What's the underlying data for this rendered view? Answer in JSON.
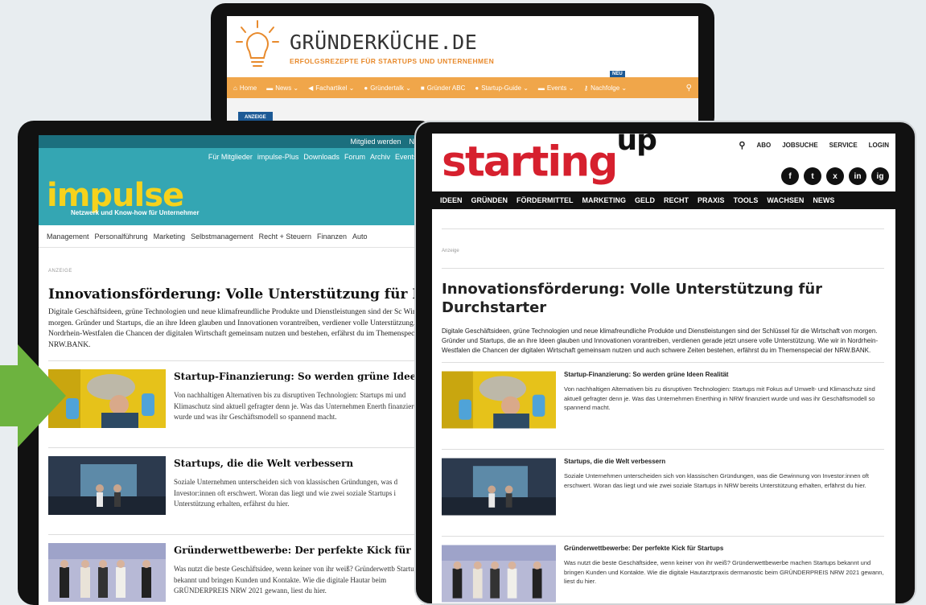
{
  "gruenderkueche": {
    "title": "GRÜNDERKÜCHE.DE",
    "subtitle": "ERFOLGSREZEPTE FÜR STARTUPS UND UNTERNEHMEN",
    "neu_badge": "NEU",
    "nav": [
      {
        "icon": "home-icon",
        "label": "Home"
      },
      {
        "icon": "news-icon",
        "label": "News ⌄"
      },
      {
        "icon": "megaphone-icon",
        "label": "Fachartikel ⌄"
      },
      {
        "icon": "chat-icon",
        "label": "Gründertalk ⌄"
      },
      {
        "icon": "book-icon",
        "label": "Gründer ABC"
      },
      {
        "icon": "bulb-icon",
        "label": "Startup-Guide ⌄"
      },
      {
        "icon": "calendar-icon",
        "label": "Events ⌄"
      },
      {
        "icon": "key-icon",
        "label": "Nachfolge ⌄"
      }
    ],
    "ad_label": "ANZEIGE",
    "accent": "#f0a64a"
  },
  "impulse": {
    "topbar": [
      "Mitglied werden",
      "Newsle"
    ],
    "links": [
      "Für Mitglieder",
      "impulse-Plus",
      "Downloads",
      "Forum",
      "Archiv",
      "Events",
      "Hö"
    ],
    "logo": "impulse",
    "tagline": "Netzwerk und Know-how für Unternehmer",
    "categories": [
      "Management",
      "Personalführung",
      "Marketing",
      "Selbstmanagement",
      "Recht + Steuern",
      "Finanzen",
      "Auto"
    ],
    "ad_label": "ANZEIGE",
    "headline": "Innovationsförderung: Volle Unterstützung für Durchstarter",
    "intro": "Digitale Geschäftsideen, grüne Technologien und neue klimafreundliche Produkte und Dienstleistungen sind der Sc Wirtschaft von morgen. Gründer und Startups, die an ihre Ideen glauben und Innovationen vorantreiben, verdiener volle Unterstützung. Wie wir in Nordrhein-Westfalen die Chancen der digitalen Wirtschaft gemeinsam nutzen und bestehen, erfährst du im Themenspecial der NRW.BANK.",
    "articles": [
      {
        "title": "Startup-Finanzierung: So werden grüne Ideen Realit",
        "text": "Von nachhaltigen Alternativen bis zu disruptiven Technologien: Startups mi und Klimaschutz sind aktuell gefragter denn je. Was das Unternehmen Enerth finanziert wurde und was ihr Geschäftsmodell so spannend macht."
      },
      {
        "title": "Startups, die die Welt verbessern",
        "text": "Soziale Unternehmen unterscheiden sich von klassischen Gründungen, was d Investor:innen oft erschwert. Woran das liegt und wie zwei soziale Startups i Unterstützung erhalten, erfährst du hier."
      },
      {
        "title": "Gründerwettbewerbe: Der perfekte Kick für Startups",
        "text": "Was nutzt die beste Geschäftsidee, wenn keiner von ihr weiß? Gründerwettb Startups bekannt und bringen Kunden und Kontakte. Wie die digitale Hautar beim GRÜNDERPREIS NRW 2021 gewann, liest du hier."
      }
    ]
  },
  "startingup": {
    "logo_main": "starting",
    "logo_sup": "up",
    "util": [
      "ABO",
      "JOBSUCHE",
      "SERVICE",
      "LOGIN"
    ],
    "social": [
      "f",
      "t",
      "x",
      "in",
      "ig"
    ],
    "nav": [
      "IDEEN",
      "GRÜNDEN",
      "FÖRDERMITTEL",
      "MARKETING",
      "GELD",
      "RECHT",
      "PRAXIS",
      "TOOLS",
      "WACHSEN",
      "NEWS"
    ],
    "ad_label": "Anzeige",
    "headline": "Innovationsförderung: Volle Unterstützung für Durchstarter",
    "intro": "Digitale Geschäftsideen, grüne Technologien und neue klimafreundliche Produkte und Dienstleistungen sind der Schlüssel für die Wirtschaft von morgen. Gründer und Startups, die an ihre Ideen glauben und Innovationen vorantreiben, verdienen gerade jetzt unsere volle Unterstützung. Wie wir in Nordrhein-Westfalen die Chancen der digitalen Wirtschaft gemeinsam nutzen und auch schwere Zeiten bestehen, erfährst du im Themenspecial der NRW.BANK.",
    "articles": [
      {
        "title": "Startup-Finanzierung: So werden grüne Ideen Realität",
        "text": "Von nachhaltigen Alternativen bis zu disruptiven Technologien: Startups mit Fokus auf Umwelt- und Klimaschutz sind aktuell gefragter denn je. Was das Unternehmen Enerthing in NRW finanziert wurde und was ihr Geschäftsmodell so spannend macht."
      },
      {
        "title": "Startups, die die Welt verbessern",
        "text": "Soziale Unternehmen unterscheiden sich von klassischen Gründungen, was die Gewinnung von Investor:innen oft erschwert. Woran das liegt und wie zwei soziale Startups in NRW bereits Unterstützung erhalten, erfährst du hier."
      },
      {
        "title": "Gründerwettbewerbe: Der perfekte Kick für Startups",
        "text": "Was nutzt die beste Geschäftsidee, wenn keiner von ihr weiß? Gründerwettbewerbe machen Startups bekannt und bringen Kunden und Kontakte. Wie die digitale Hautarztpraxis dermanostic beim GRÜNDERPREIS NRW 2021 gewann, liest du hier."
      }
    ],
    "accent": "#d6202e"
  },
  "arrow_color": "#6db33f"
}
